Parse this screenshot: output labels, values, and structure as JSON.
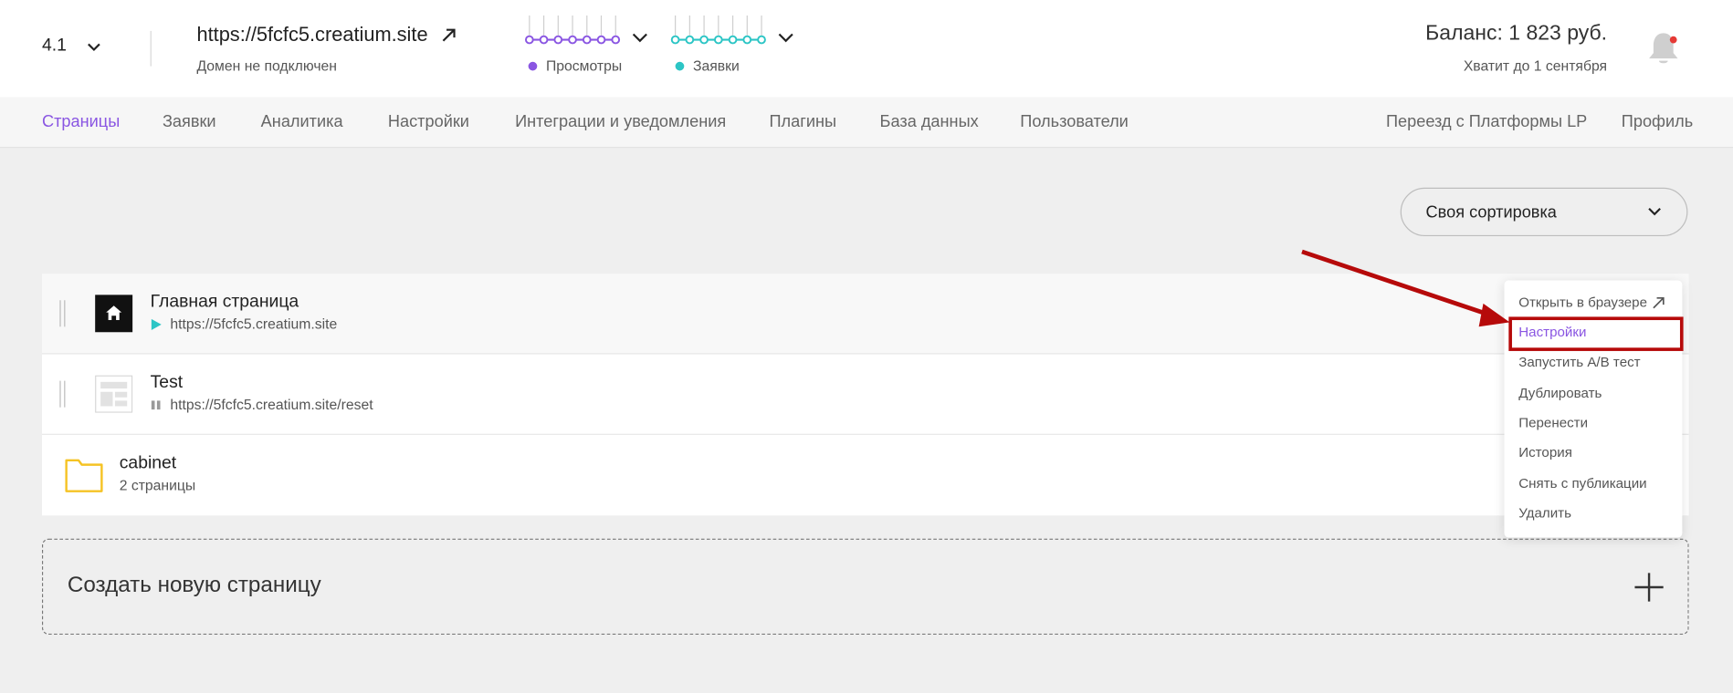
{
  "header": {
    "version": "4.1",
    "site_url": "https://5fcfc5.creatium.site",
    "site_sub": "Домен не подключен",
    "views_label": "Просмотры",
    "leads_label": "Заявки",
    "balance": "Баланс: 1 823 руб.",
    "balance_sub": "Хватит до 1 сентября"
  },
  "nav": {
    "items": [
      "Страницы",
      "Заявки",
      "Аналитика",
      "Настройки",
      "Интеграции и уведомления",
      "Плагины",
      "База данных",
      "Пользователи"
    ],
    "right_items": [
      "Переезд с Платформы LP",
      "Профиль"
    ]
  },
  "sort": {
    "label": "Своя сортировка"
  },
  "pages": [
    {
      "title": "Главная страница",
      "url": "https://5fcfc5.creatium.site"
    },
    {
      "title": "Test",
      "url": "https://5fcfc5.creatium.site/reset"
    }
  ],
  "folder": {
    "title": "cabinet",
    "sub": "2 страницы"
  },
  "create": {
    "label": "Создать новую страницу"
  },
  "menu": {
    "items": [
      "Открыть в браузере",
      "Настройки",
      "Запустить A/B тест",
      "Дублировать",
      "Перенести",
      "История",
      "Снять с публикации",
      "Удалить"
    ]
  },
  "colors": {
    "accent": "#8a56e2",
    "teal": "#2cc5c5",
    "highlight": "#b60a0a",
    "folder": "#f5c324"
  }
}
